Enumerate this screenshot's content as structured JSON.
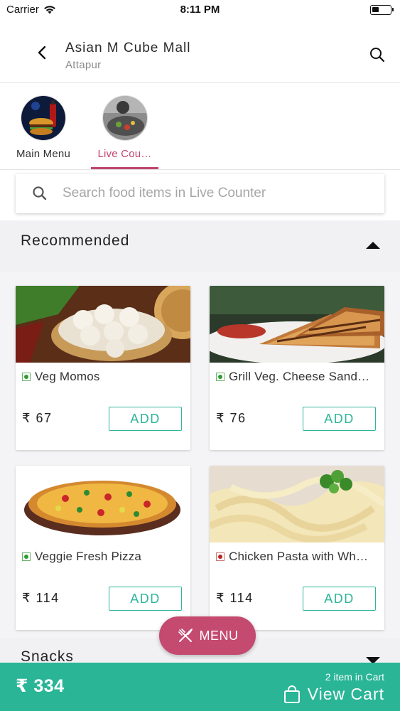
{
  "status_bar": {
    "carrier": "Carrier",
    "time": "8:11 PM"
  },
  "header": {
    "title": "Asian M Cube Mall",
    "subtitle": "Attapur"
  },
  "menu_tabs": [
    {
      "label": "Main Menu",
      "active": false
    },
    {
      "label": "Live Cou…",
      "active": true
    }
  ],
  "search": {
    "placeholder": "Search food items in Live Counter",
    "value": ""
  },
  "sections": [
    {
      "title": "Recommended",
      "expanded": true
    },
    {
      "title": "Snacks",
      "expanded": false
    }
  ],
  "items": [
    {
      "name": "Veg Momos",
      "price": "₹ 67",
      "veg": true,
      "add_label": "ADD"
    },
    {
      "name": "Grill Veg. Cheese Sand…",
      "price": "₹ 76",
      "veg": true,
      "add_label": "ADD"
    },
    {
      "name": "Veggie Fresh Pizza",
      "price": "₹ 114",
      "veg": true,
      "add_label": "ADD"
    },
    {
      "name": "Chicken Pasta with Wh…",
      "price": "₹ 114",
      "veg": false,
      "add_label": "ADD"
    }
  ],
  "fab": {
    "label": "MENU",
    "icon": "fork-knife-icon"
  },
  "cart": {
    "total": "₹ 334",
    "count_text": "2 item in Cart",
    "view_label": "View Cart",
    "icon": "shopping-bag-icon"
  },
  "colors": {
    "accent": "#c0456d",
    "fab": "#c44a70",
    "primary_green": "#2ab597",
    "add_border": "#2fb59b"
  }
}
